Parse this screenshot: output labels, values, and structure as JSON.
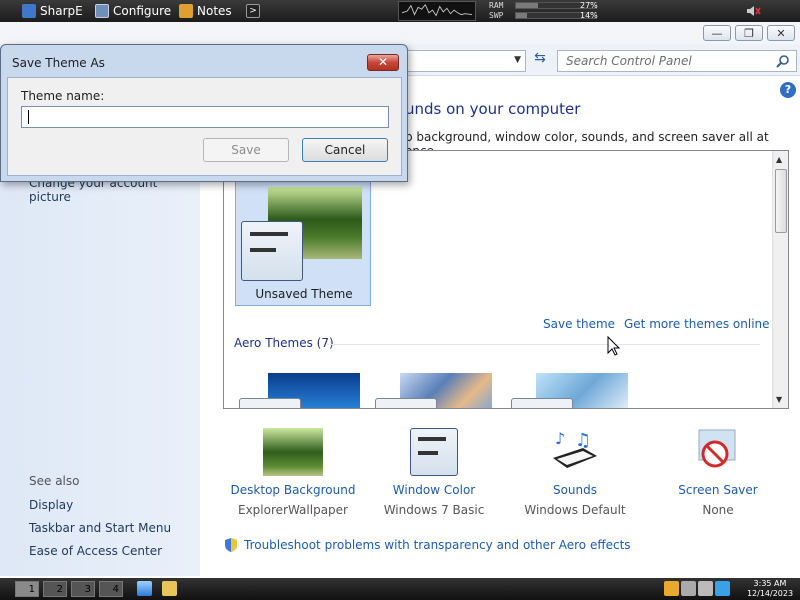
{
  "top_taskbar": {
    "apps": [
      {
        "label": "SharpE",
        "icon": "sharpe-icon"
      },
      {
        "label": "Configure",
        "icon": "monitor-icon"
      },
      {
        "label": "Notes",
        "icon": "notes-icon"
      },
      {
        "label": "",
        "icon": "terminal-icon"
      }
    ],
    "ram_label": "RAM",
    "swp_label": "SWP",
    "ram_value": "27%",
    "swp_value": "14%",
    "ram_fraction": 0.27,
    "swp_fraction": 0.14
  },
  "window": {
    "caption_minimize": "—",
    "caption_maximize": "❐",
    "caption_close": "✕"
  },
  "address_bar": {
    "search_placeholder": "Search Control Panel"
  },
  "main": {
    "heading": "unds on your computer",
    "description": "p background, window color, sounds, and screen saver all at once.",
    "unsaved_theme_label": "Unsaved Theme",
    "save_theme_link": "Save theme",
    "get_more_link": "Get more themes online",
    "aero_header": "Aero Themes (7)"
  },
  "left_nav": {
    "account_picture": "Change your account picture",
    "see_also": "See also",
    "links": [
      "Display",
      "Taskbar and Start Menu",
      "Ease of Access Center"
    ]
  },
  "options": [
    {
      "title": "Desktop Background",
      "subtitle": "ExplorerWallpaper"
    },
    {
      "title": "Window Color",
      "subtitle": "Windows 7 Basic"
    },
    {
      "title": "Sounds",
      "subtitle": "Windows Default"
    },
    {
      "title": "Screen Saver",
      "subtitle": "None"
    }
  ],
  "troubleshoot_link": "Troubleshoot problems with transparency and other Aero effects",
  "dialog": {
    "title": "Save Theme As",
    "close_label": "✕",
    "field_label": "Theme name:",
    "field_value": "",
    "save_label": "Save",
    "cancel_label": "Cancel"
  },
  "bottom_taskbar": {
    "workspaces": [
      "1",
      "2",
      "3",
      "4"
    ],
    "time": "3:35 AM",
    "date": "12/14/2023"
  },
  "colors": {
    "link": "#1e5ba8",
    "heading": "#1e3287",
    "selection": "#cfe0f7"
  }
}
